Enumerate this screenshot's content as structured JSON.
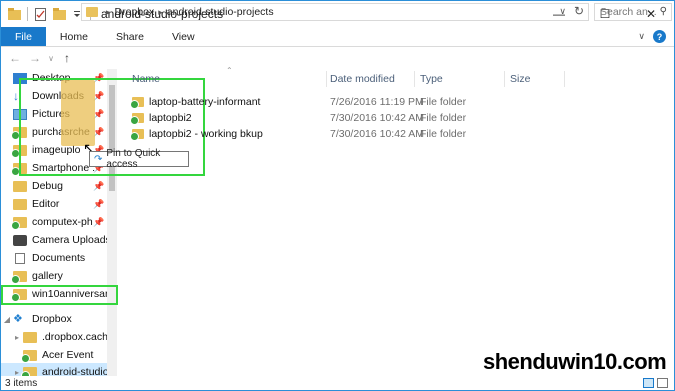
{
  "window": {
    "title": "android-studio-projects",
    "controls": {
      "minimize": "—",
      "maximize": "☐",
      "close": "✕"
    }
  },
  "ribbon": {
    "tabs": [
      "File",
      "Home",
      "Share",
      "View"
    ]
  },
  "address": {
    "crumbs": [
      "Dropbox",
      "android-studio-projects"
    ],
    "search_placeholder": "Search an..."
  },
  "nav_pane": {
    "items": [
      {
        "label": "Desktop",
        "icon": "desktop-icon",
        "pinned": true
      },
      {
        "label": "Downloads",
        "icon": "download-arrow-icon",
        "pinned": true
      },
      {
        "label": "Pictures",
        "icon": "pictures-icon",
        "pinned": true
      },
      {
        "label": "purchasrche",
        "icon": "folder-synced-icon",
        "pinned": true
      },
      {
        "label": "imageuplo",
        "icon": "folder-synced-icon",
        "pinned": true
      },
      {
        "label": "Smartphone :",
        "icon": "folder-synced-icon",
        "pinned": true
      },
      {
        "label": "Debug",
        "icon": "folder-icon",
        "pinned": true
      },
      {
        "label": "Editor",
        "icon": "folder-icon",
        "pinned": true
      },
      {
        "label": "computex-ph",
        "icon": "folder-synced-icon",
        "pinned": true
      },
      {
        "label": "Camera Uploads",
        "icon": "camera-folder-icon",
        "pinned": false
      },
      {
        "label": "Documents",
        "icon": "documents-icon",
        "pinned": false
      },
      {
        "label": "gallery",
        "icon": "folder-synced-icon",
        "pinned": false
      },
      {
        "label": "win10anniversar",
        "icon": "folder-synced-icon",
        "pinned": false
      },
      {
        "label": "Dropbox",
        "icon": "dropbox-icon",
        "pinned": false
      },
      {
        "label": ".dropbox.cache",
        "icon": "folder-icon",
        "pinned": false
      },
      {
        "label": "Acer Event",
        "icon": "folder-synced-icon",
        "pinned": false
      },
      {
        "label": "android-studio-",
        "icon": "folder-synced-icon",
        "pinned": false
      }
    ]
  },
  "drag": {
    "tooltip": "Pin to Quick access"
  },
  "list": {
    "columns": [
      "Name",
      "Date modified",
      "Type",
      "Size"
    ],
    "rows": [
      {
        "name": "laptop-battery-informant",
        "date": "7/26/2016 11:19 PM",
        "type": "File folder"
      },
      {
        "name": "laptopbi2",
        "date": "7/30/2016 10:42 AM",
        "type": "File folder"
      },
      {
        "name": "laptopbi2 - working bkup",
        "date": "7/30/2016 10:42 AM",
        "type": "File folder"
      }
    ]
  },
  "status": {
    "items_count": "3 items"
  },
  "watermark": "shenduwin10.com",
  "colors": {
    "accent": "#1979ca",
    "folder": "#e8bf56",
    "sync_green": "#3aa541",
    "highlight_box": "#34d63e"
  }
}
